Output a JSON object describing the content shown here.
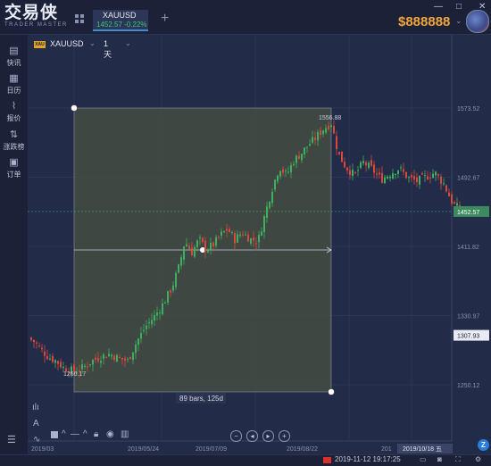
{
  "app": {
    "logo": "交易侠",
    "logo_sub": "TRADER MASTER"
  },
  "tab": {
    "symbol": "XAUUSD",
    "price": "1452.57",
    "change": "-0.22%"
  },
  "header": {
    "add_tab": "+",
    "balance": "$888888",
    "window_controls": [
      "—",
      "□",
      "✕"
    ]
  },
  "sidebar": {
    "items": [
      {
        "label": "快讯",
        "icon": "news-icon",
        "glyph": "▤"
      },
      {
        "label": "日历",
        "icon": "calendar-icon",
        "glyph": "▦"
      },
      {
        "label": "报价",
        "icon": "quote-icon",
        "glyph": "⌇"
      },
      {
        "label": "涨跌榜",
        "icon": "ranking-icon",
        "glyph": "⇅"
      },
      {
        "label": "订单",
        "icon": "order-icon",
        "glyph": "▣"
      }
    ]
  },
  "chart_toolbar": {
    "symbol_badge": "XAU",
    "symbol": "XAUUSD",
    "timeframe": "1天"
  },
  "chart_data": {
    "type": "candlestick",
    "y_ticks": [
      "1573.52",
      "1492.67",
      "1411.82",
      "1330.97",
      "1250.12"
    ],
    "ylim": [
      1230,
      1590
    ],
    "x_ticks": [
      "2019/05/24",
      "2019/07/09",
      "2019/08/22"
    ],
    "x_tick_partial_left": "2019/03",
    "x_tick_partial_right": "201",
    "current_price": "1452.57",
    "crosshair_price": "1307.93",
    "crosshair_date": "2019/10/18 五",
    "range_measure": {
      "high_label": "1556.88",
      "low_label": "1266.17",
      "summary": "89 bars, 125d"
    },
    "colors": {
      "up": "#3fae5e",
      "down": "#d9473d",
      "selection": "#4a5141"
    }
  },
  "nav_buttons": [
    "−",
    "◂",
    "▸",
    "+"
  ],
  "status": {
    "datetime": "2019-11-12 19:17:25",
    "brand": "Z"
  }
}
